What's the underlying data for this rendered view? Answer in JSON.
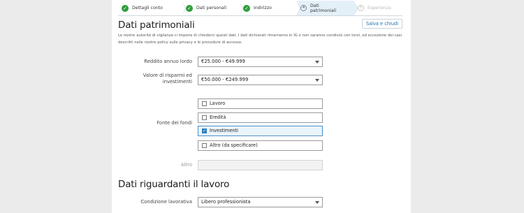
{
  "stepper": {
    "steps": [
      {
        "label": "Dettagli conto",
        "state": "done"
      },
      {
        "label": "Dati personali",
        "state": "done"
      },
      {
        "label": "Indirizzo",
        "state": "done"
      },
      {
        "number": "4",
        "label_line1": "Dati",
        "label_line2": "patrimoniali",
        "state": "active"
      },
      {
        "number": "5",
        "label": "Esperienza",
        "state": "future"
      }
    ]
  },
  "save_button": "Salva e chiudi",
  "section1": {
    "title": "Dati patrimoniali",
    "intro": "Le nostre autorità di vigilanza ci impone di chiederci questi dati. I dati dichiarati rimarranno in IG e non saranno condivisi con terzi, ed eccezione dei casi descritti nelle nostre policy sulle privacy e le procedure di accesso."
  },
  "fields": {
    "income": {
      "label": "Reddito annuo lordo",
      "value": "€25.000 - €49.999"
    },
    "savings": {
      "label_line1": "Valore di risparmi ed",
      "label_line2": "investimenti",
      "value": "€50.000 - €249.999"
    },
    "funds": {
      "label": "Fonte dei fondi",
      "options": [
        {
          "label": "Lavoro",
          "checked": false
        },
        {
          "label": "Eredità",
          "checked": false
        },
        {
          "label": "Investimenti",
          "checked": true
        },
        {
          "label": "Altro (da specificare)",
          "checked": false
        }
      ]
    },
    "other": {
      "label": "Altro",
      "value": ""
    }
  },
  "section2": {
    "title": "Dati riguardanti il lavoro"
  },
  "employment": {
    "label": "Condizione lavorativa",
    "value": "Libero professionista"
  },
  "colors": {
    "accent": "#2d7fc1",
    "done": "#2f9e3a",
    "active_step_bg": "#e4f0f8"
  }
}
